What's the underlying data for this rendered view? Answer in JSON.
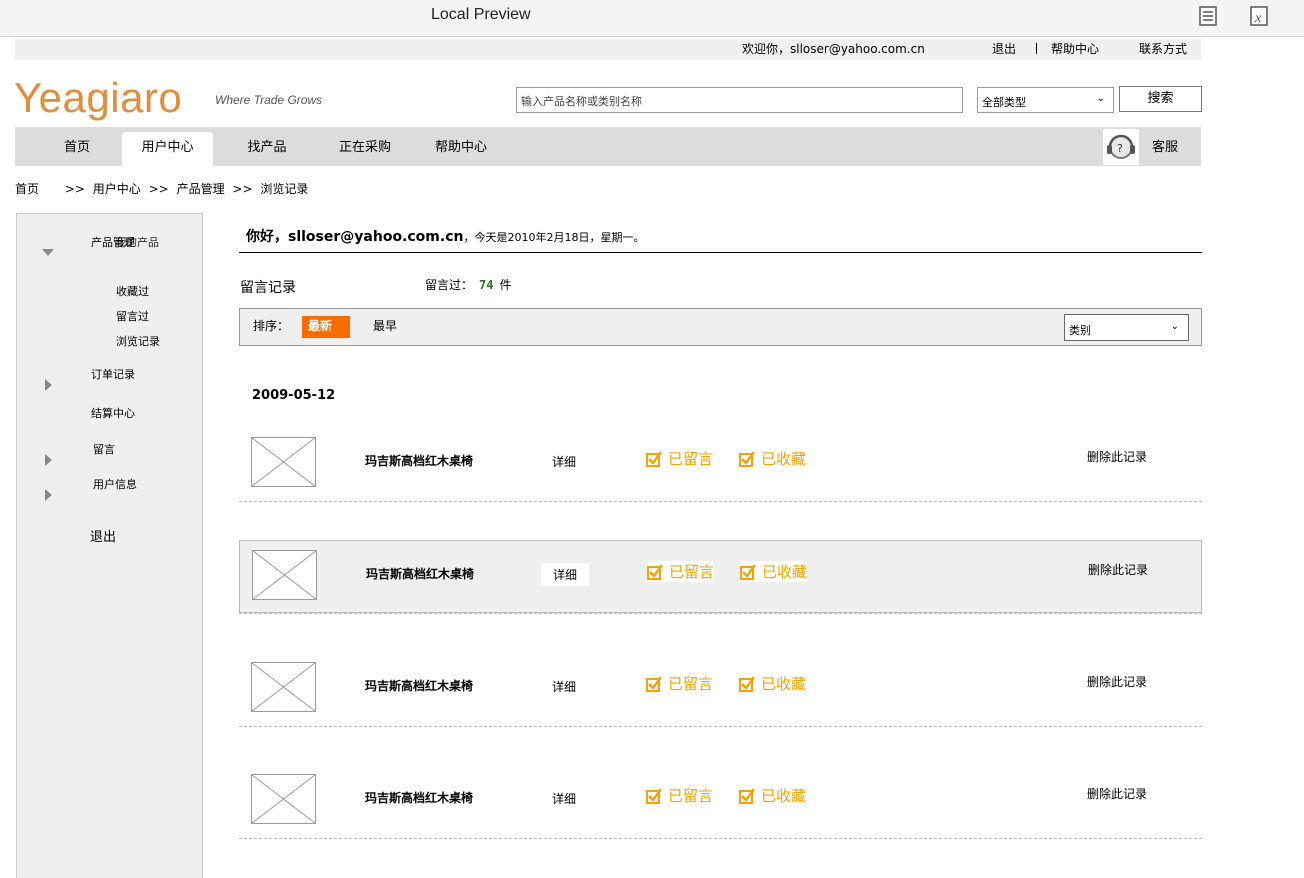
{
  "chrome": {
    "title": "Local Preview",
    "icons": [
      "document-icon",
      "excel-icon"
    ]
  },
  "util_bar": {
    "welcome": "欢迎你，slloser@yahoo.com.cn",
    "logout": "退出",
    "help": "帮助中心",
    "contact": "联系方式"
  },
  "brand": {
    "logo": "Yeagiaro",
    "slogan": "Where Trade Grows",
    "logo_color": "#e08d3c"
  },
  "search": {
    "placeholder": "输入产品名称或类别名称",
    "type_value": "全部类型",
    "button": "搜索"
  },
  "nav": {
    "items": [
      "首页",
      "用户中心",
      "找产品",
      "正在采购",
      "帮助中心"
    ],
    "active_index": 1,
    "service": "客服"
  },
  "breadcrumb": {
    "items": [
      "首页",
      ">>",
      "用户中心",
      ">>",
      "产品管理",
      ">>",
      "浏览记录"
    ]
  },
  "sidebar": {
    "group_title_a": "产品管理",
    "group_title_b": "我的产品",
    "sub_items": [
      "收藏过",
      "留言过",
      "浏览记录"
    ],
    "items": [
      "订单记录",
      "结算中心",
      "留言",
      "用户信息"
    ],
    "logout": "退出"
  },
  "main": {
    "greeting_user": "你好，slloser@yahoo.com.cn",
    "greeting_date": "，今天是2010年2月18日，星期一。",
    "section_title": "留言记录",
    "count_label": "留言过：",
    "count_value": "74",
    "count_unit": "件",
    "sort_label": "排序：",
    "sort_newest": "最新",
    "sort_oldest": "最早",
    "category_value": "类别",
    "accent_color": "#f96c00"
  },
  "records": {
    "date": "2009-05-12",
    "rows": [
      {
        "name": "玛吉斯高档红木桌椅",
        "detail": "详细",
        "msg": "已留言",
        "fav": "已收藏",
        "delete": "删除此记录"
      },
      {
        "name": "玛吉斯高档红木桌椅",
        "detail": "详细",
        "msg": "已留言",
        "fav": "已收藏",
        "delete": "删除此记录"
      },
      {
        "name": "玛吉斯高档红木桌椅",
        "detail": "详细",
        "msg": "已留言",
        "fav": "已收藏",
        "delete": "删除此记录"
      },
      {
        "name": "玛吉斯高档红木桌椅",
        "detail": "详细",
        "msg": "已留言",
        "fav": "已收藏",
        "delete": "删除此记录"
      }
    ],
    "badge_color": "#f5a300"
  }
}
